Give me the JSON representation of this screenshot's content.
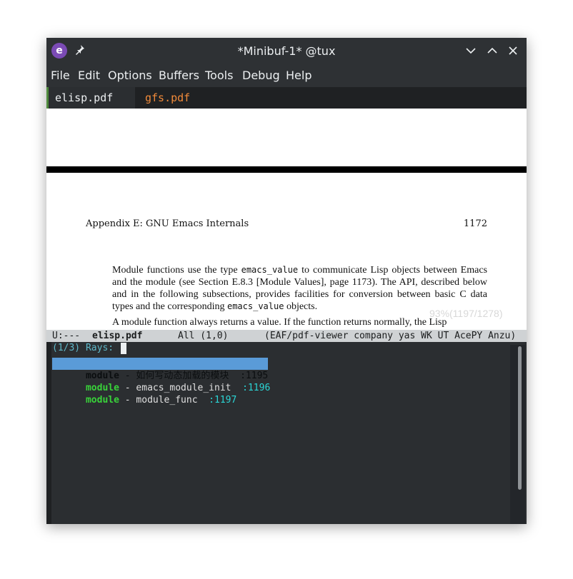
{
  "window": {
    "title": "*Minibuf-1* @tux",
    "app_icon": "emacs-icon",
    "app_icon_glyph": "e",
    "pin_icon": "pin-icon",
    "controls": [
      "minimize-icon",
      "maximize-icon",
      "close-icon"
    ]
  },
  "menu": [
    "File",
    "Edit",
    "Options",
    "Buffers",
    "Tools",
    "Debug",
    "Help"
  ],
  "tabs": [
    {
      "label": "elisp.pdf",
      "active": true
    },
    {
      "label": "gfs.pdf",
      "active": false
    }
  ],
  "pdf": {
    "header_left": "Appendix E: GNU Emacs Internals",
    "header_right": "1172",
    "para1_a": "Module functions use the type ",
    "para1_code1": "emacs_value",
    "para1_b": " to communicate Lisp objects between Emacs and the module (see Section E.8.3 [Module Values], page 1173). The API, described below and in the following subsections, provides facilities for conversion between basic C data types and the corresponding ",
    "para1_code2": "emacs_value",
    "para1_c": " objects.",
    "para2": "A module function always returns a value. If the function returns normally, the Lisp",
    "overlay": "93%(1197/1278)"
  },
  "modeline": {
    "status": "U:---",
    "buffer": "elisp.pdf",
    "position": "All (1,0)",
    "modes": "(EAF/pdf-viewer company yas WK UT AcePY Anzu)"
  },
  "minibuffer": {
    "prompt": "(1/3) Rays:",
    "candidates": [
      {
        "keyword": "module",
        "separator": " - ",
        "text": "如何写动态加载的模块",
        "page": ":1195",
        "selected": true
      },
      {
        "keyword": "module",
        "separator": " - ",
        "text": "emacs_module_init",
        "page": ":1196",
        "selected": false
      },
      {
        "keyword": "module",
        "separator": " - ",
        "text": "module_func",
        "page": ":1197",
        "selected": false
      }
    ]
  },
  "colors": {
    "accent_tab": "#f08a3a",
    "selection": "#5a9bd8",
    "keyword": "#39d33a",
    "page_number": "#2bd5d5"
  }
}
